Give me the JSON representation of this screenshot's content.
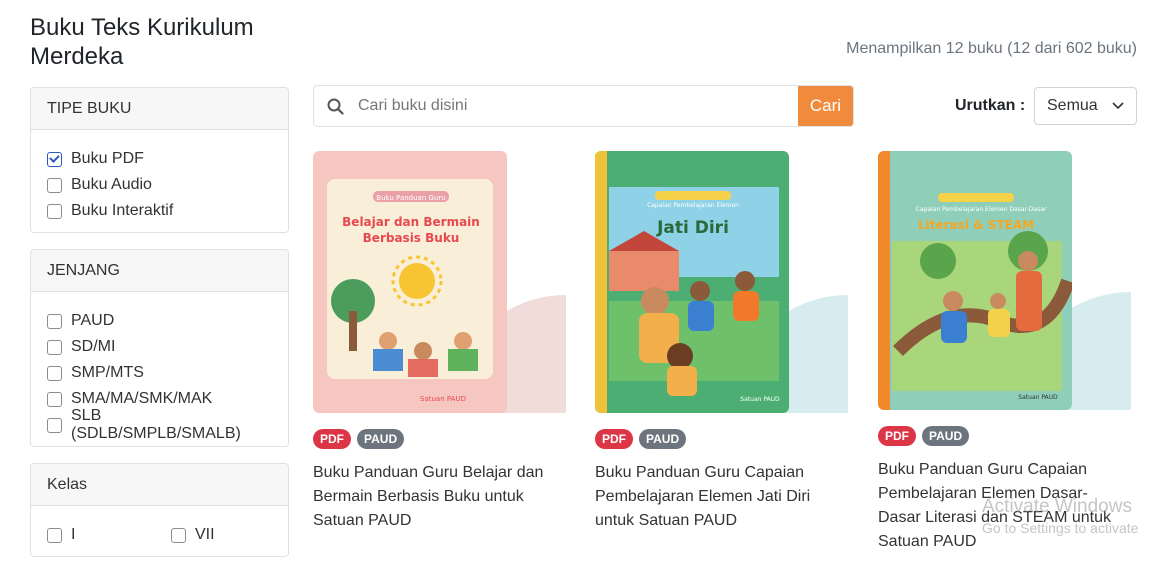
{
  "header": {
    "title": "Buku Teks Kurikulum Merdeka",
    "result_count": "Menampilkan 12 buku (12 dari 602 buku)"
  },
  "filters": {
    "tipe_buku": {
      "title": "TIPE BUKU",
      "options": [
        {
          "label": "Buku PDF",
          "checked": true
        },
        {
          "label": "Buku Audio",
          "checked": false
        },
        {
          "label": "Buku Interaktif",
          "checked": false
        }
      ]
    },
    "jenjang": {
      "title": "JENJANG",
      "options": [
        {
          "label": "PAUD",
          "checked": false
        },
        {
          "label": "SD/MI",
          "checked": false
        },
        {
          "label": "SMP/MTS",
          "checked": false
        },
        {
          "label": "SMA/MA/SMK/MAK",
          "checked": false
        },
        {
          "label": "SLB (SDLB/SMPLB/SMALB)",
          "checked": false
        }
      ]
    },
    "kelas": {
      "title": "Kelas",
      "options": [
        {
          "label": "I",
          "checked": false
        },
        {
          "label": "VII",
          "checked": false
        }
      ]
    }
  },
  "search": {
    "placeholder": "Cari buku disini",
    "button_label": "Cari"
  },
  "sort": {
    "label": "Urutkan :",
    "selected": "Semua"
  },
  "books": [
    {
      "badges": [
        "PDF",
        "PAUD"
      ],
      "title": "Buku Panduan Guru Belajar dan Bermain Berbasis Buku untuk Satuan PAUD",
      "cover_heading": "Belajar dan Bermain Berbasis Buku",
      "cover_kicker": "Buku Panduan Guru",
      "cover_footer": "Satuan PAUD",
      "cover_color": "#f7c9c6",
      "circle_color": "#f0ddd9"
    },
    {
      "badges": [
        "PDF",
        "PAUD"
      ],
      "title": "Buku Panduan Guru Capaian Pembelajaran Elemen Jati Diri untuk Satuan PAUD",
      "cover_heading": "Jati Diri",
      "cover_kicker": "Capaian Pembelajaran Elemen",
      "cover_footer": "Satuan PAUD",
      "cover_color": "#4cae73",
      "circle_color": "#d7ecee"
    },
    {
      "badges": [
        "PDF",
        "PAUD"
      ],
      "title": "Buku Panduan Guru Capaian Pembelajaran Elemen Dasar-Dasar Literasi dan STEAM untuk Satuan PAUD",
      "cover_heading": "Literasi & STEAM",
      "cover_kicker": "Capaian Pembelajaran Elemen Dasar-Dasar",
      "cover_footer": "Satuan PAUD",
      "cover_color": "#8fcfb9",
      "circle_color": "#d7ecee"
    }
  ],
  "watermark": {
    "line1": "Activate Windows",
    "line2": "Go to Settings to activate"
  },
  "colors": {
    "accent": "#f08a3c",
    "pdf_badge": "#dc3545",
    "level_badge": "#6c757d",
    "checkbox_checked": "#2b59c3"
  }
}
